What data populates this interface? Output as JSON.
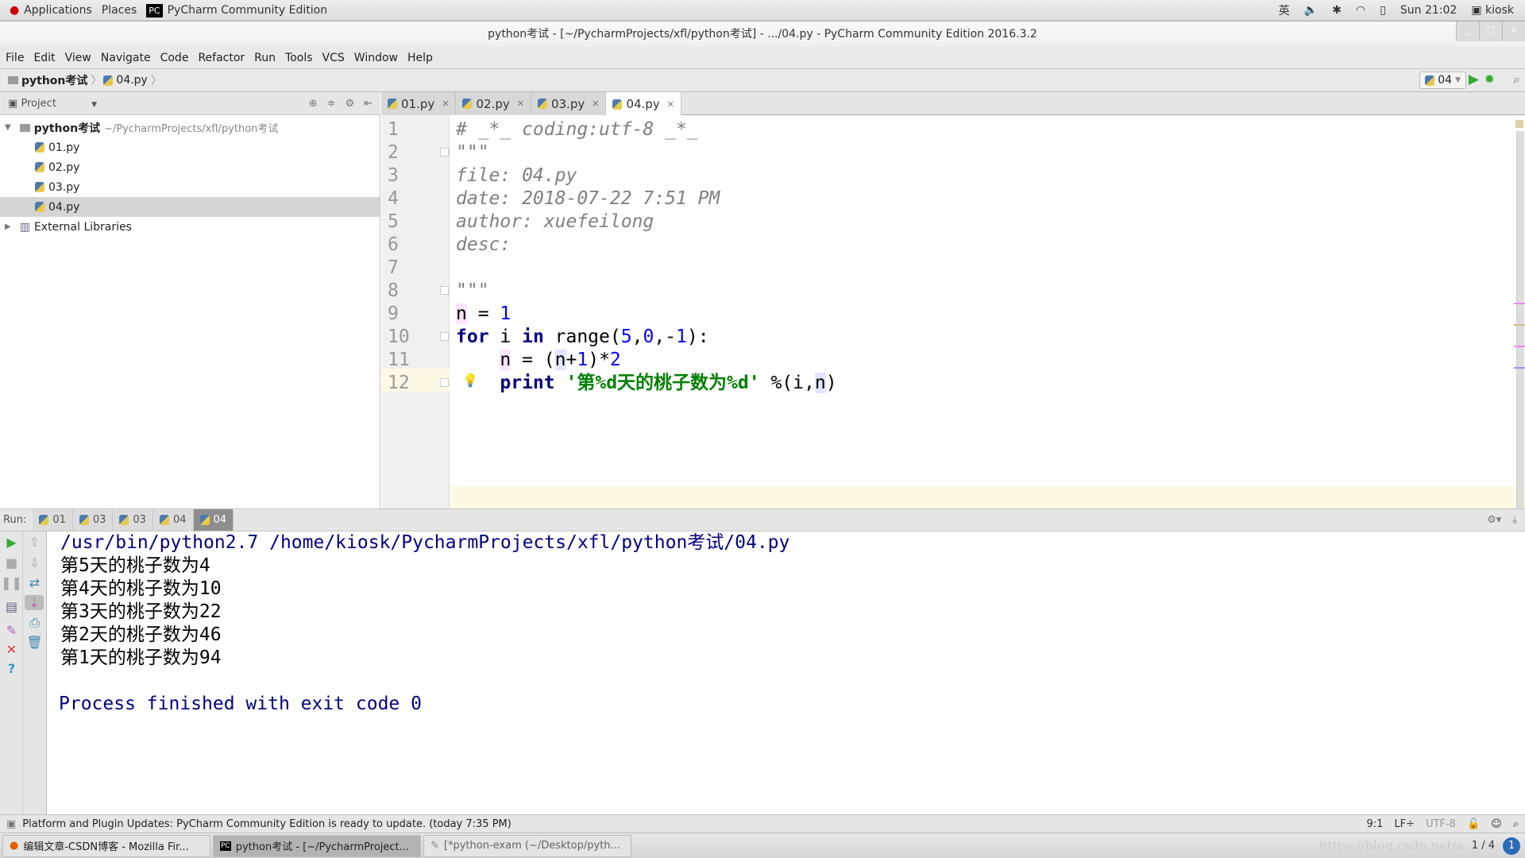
{
  "topbar": {
    "applications": "Applications",
    "places": "Places",
    "app_name": "PyCharm Community Edition",
    "ime": "英",
    "clock": "Sun 21:02",
    "user": "kiosk"
  },
  "window": {
    "title": "python考试 - [~/PycharmProjects/xfl/python考试] - .../04.py - PyCharm Community Edition 2016.3.2"
  },
  "menu": [
    "File",
    "Edit",
    "View",
    "Navigate",
    "Code",
    "Refactor",
    "Run",
    "Tools",
    "VCS",
    "Window",
    "Help"
  ],
  "breadcrumb": {
    "project": "python考试",
    "file": "04.py"
  },
  "run_config": {
    "label": "04"
  },
  "project_panel": {
    "label": "Project",
    "root": "python考试",
    "root_path": "~/PycharmProjects/xfl/python考试",
    "files": [
      "01.py",
      "02.py",
      "03.py",
      "04.py"
    ],
    "selected": "04.py",
    "external": "External Libraries"
  },
  "tabs": [
    {
      "label": "01.py"
    },
    {
      "label": "02.py"
    },
    {
      "label": "03.py"
    },
    {
      "label": "04.py",
      "active": true
    }
  ],
  "code": [
    [
      [
        "# _*_ coding:utf-8 _*_",
        "cm"
      ]
    ],
    [
      [
        "\"\"\"",
        "ds"
      ]
    ],
    [
      [
        "file: 04.py",
        "ds"
      ]
    ],
    [
      [
        "date: 2018-07-22 7:51 PM",
        "ds"
      ]
    ],
    [
      [
        "author: xuefeilong",
        "ds"
      ]
    ],
    [
      [
        "desc:",
        "ds"
      ]
    ],
    [],
    [
      [
        "\"\"\"",
        "ds"
      ]
    ],
    [
      [
        "n",
        "hl"
      ],
      [
        " = ",
        ""
      ],
      [
        "1",
        "num"
      ]
    ],
    [
      [
        "for",
        "kw"
      ],
      [
        " i ",
        ""
      ],
      [
        "in",
        "kw"
      ],
      [
        " range(",
        ""
      ],
      [
        "5",
        "num"
      ],
      [
        ",",
        ""
      ],
      [
        "0",
        "num"
      ],
      [
        ",-",
        ""
      ],
      [
        "1",
        "num"
      ],
      [
        "):",
        ""
      ]
    ],
    [
      [
        "    ",
        ""
      ],
      [
        "n",
        "hl"
      ],
      [
        " = (",
        ""
      ],
      [
        "n",
        "hl2"
      ],
      [
        "+",
        ""
      ],
      [
        "1",
        "num"
      ],
      [
        ")*",
        ""
      ],
      [
        "2",
        "num"
      ]
    ],
    [
      [
        "    ",
        ""
      ],
      [
        "print",
        "kw"
      ],
      [
        " ",
        ""
      ],
      [
        "'第%d天的桃子数为%d'",
        "str"
      ],
      [
        " %(i,",
        ""
      ],
      [
        "n",
        "hl2"
      ],
      [
        ")",
        ""
      ]
    ]
  ],
  "run": {
    "label": "Run:",
    "tabs": [
      "01",
      "03",
      "03",
      "04",
      "04"
    ],
    "active_tab": 4
  },
  "console": {
    "command": "/usr/bin/python2.7 /home/kiosk/PycharmProjects/xfl/python考试/04.py",
    "output": [
      "第5天的桃子数为4",
      "第4天的桃子数为10",
      "第3天的桃子数为22",
      "第2天的桃子数为46",
      "第1天的桃子数为94"
    ],
    "exit": "Process finished with exit code 0"
  },
  "status": {
    "message": "Platform and Plugin Updates: PyCharm Community Edition is ready to update. (today 7:35 PM)",
    "position": "9:1",
    "line_sep": "LF÷",
    "encoding": "UTF-8"
  },
  "taskbar": {
    "items": [
      "编辑文章-CSDN博客 - Mozilla Fir...",
      "python考试 - [~/PycharmProject...",
      "[*python-exam (~/Desktop/pyth..."
    ],
    "watermark": "https://blog.csdn.net/a",
    "pager": "1 / 4"
  }
}
